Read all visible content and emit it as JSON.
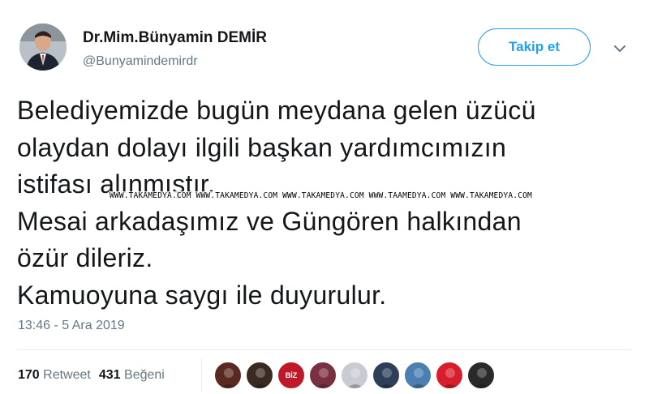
{
  "user": {
    "name": "Dr.Mim.Bünyamin DEMİR",
    "handle": "@Bunyamindemirdr"
  },
  "actions": {
    "follow_label": "Takip et",
    "more_icon": "chevron-down-icon"
  },
  "tweet": {
    "lines": [
      "Belediyemizde bugün meydana gelen üzücü",
      "olaydan dolayı ilgili başkan yardımcımızın",
      "istifası alınmıştır.",
      "Mesai arkadaşımız ve Güngören halkından",
      "özür dileriz.",
      "Kamuoyuna saygı ile duyurulur."
    ],
    "watermark": "WWW.TAKAMEDYA.COM WWW.TAKAMEDYA.COM WWW.TAKAMEDYA.COM WWW.TAAMEDYA.COM WWW.TAKAMEDYA.COM",
    "timestamp": "13:46 - 5 Ara 2019"
  },
  "stats": {
    "retweets_count": "170",
    "retweets_label": "Retweet",
    "likes_count": "431",
    "likes_label": "Beğeni"
  },
  "likers": [
    {
      "name": "liker-avatar-1",
      "color": "#5a2a22"
    },
    {
      "name": "liker-avatar-2",
      "color": "#3a2a22"
    },
    {
      "name": "liker-avatar-3",
      "color": "#c0182b",
      "text": "BİZ"
    },
    {
      "name": "liker-avatar-4",
      "color": "#7a3040"
    },
    {
      "name": "liker-avatar-5",
      "color": "#c8ccd2"
    },
    {
      "name": "liker-avatar-6",
      "color": "#2e3f5a"
    },
    {
      "name": "liker-avatar-7",
      "color": "#4a7fb0"
    },
    {
      "name": "liker-avatar-8",
      "color": "#d81e2c"
    },
    {
      "name": "liker-avatar-9",
      "color": "#2a2a2a"
    }
  ],
  "colors": {
    "accent": "#1da1f2",
    "text": "#14171a",
    "muted": "#657786"
  }
}
